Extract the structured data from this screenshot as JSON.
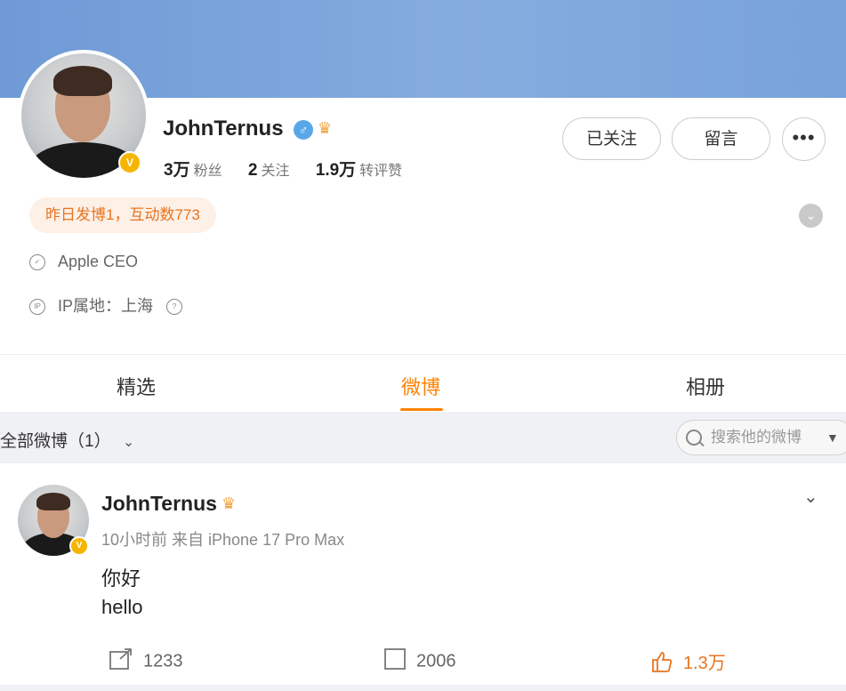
{
  "profile": {
    "name": "JohnTernus",
    "gender_icon": "male-icon",
    "verified_badge": "V",
    "stats": [
      {
        "value": "3万",
        "label": "粉丝"
      },
      {
        "value": "2",
        "label": "关注"
      },
      {
        "value": "1.9万",
        "label": "转评赞"
      }
    ],
    "buttons": {
      "follow": "已关注",
      "message": "留言",
      "more": "•••"
    },
    "activity": "昨日发博1，互动数773",
    "bio": "Apple CEO",
    "ip": "IP属地：上海"
  },
  "tabs": [
    {
      "label": "精选",
      "active": false
    },
    {
      "label": "微博",
      "active": true
    },
    {
      "label": "相册",
      "active": false
    }
  ],
  "filter": {
    "label": "全部微博（1）",
    "search_placeholder": "搜索他的微博"
  },
  "post": {
    "author": "JohnTernus",
    "meta": "10小时前 来自 iPhone 17 Pro Max",
    "lines": [
      "你好",
      "hello"
    ],
    "repost_count": "1233",
    "comment_count": "2006",
    "like_count": "1.3万"
  },
  "colors": {
    "accent": "#ff8200",
    "banner": "#7aa3db",
    "badge": "#f6b500"
  }
}
